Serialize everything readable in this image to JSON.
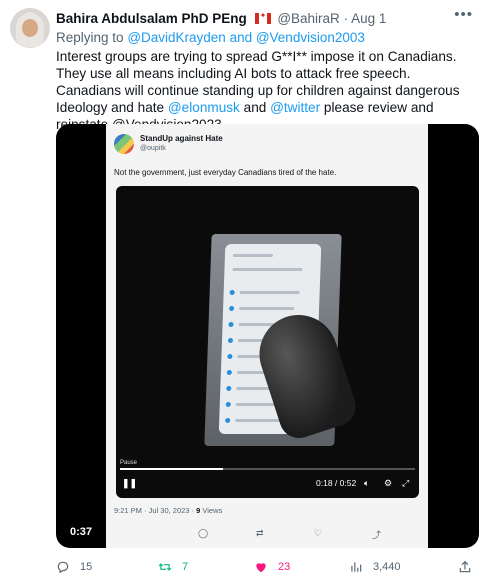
{
  "tweet": {
    "author_name": "Bahira Abdulsalam PhD PEng",
    "author_handle": "@BahiraR",
    "date": "· Aug 1",
    "reply_prefix": "Replying to",
    "reply_to": "@DavidKrayden and @Vendvision2003",
    "text_part1": "Interest groups are trying to spread G**I** impose it on Canadians. They use all means including AI bots to attack free speech. Canadians will continue standing up for children against dangerous Ideology and hate ",
    "mention_1": "@elonmusk",
    "text_and": " and ",
    "mention_2": "@twitter",
    "text_part2": " please review and reinstate @Vendvision2023"
  },
  "embedded": {
    "name": "StandUp against Hate",
    "handle": "@oupitk",
    "text": "Not the government, just everyday Canadians tired of the hate.",
    "pause_label": "Pause",
    "time": "0:18 / 0:52",
    "timestamp": "9:21 PM · Jul 30, 2023 ·",
    "views_value": "9",
    "views_word": " Views",
    "progress": 0.35
  },
  "video": {
    "duration": "0:37"
  },
  "actions": {
    "replies": "15",
    "retweets": "7",
    "likes": "23",
    "views": "3,440"
  },
  "colors": {
    "link": "#1d9bf0",
    "retweet": "#00ba7c",
    "like": "#f91880",
    "muted": "#536471"
  },
  "icons": [
    "more-icon",
    "reply-icon",
    "retweet-icon",
    "like-icon",
    "views-icon",
    "share-icon",
    "pause-icon",
    "volume-icon",
    "gear-icon",
    "expand-icon"
  ]
}
